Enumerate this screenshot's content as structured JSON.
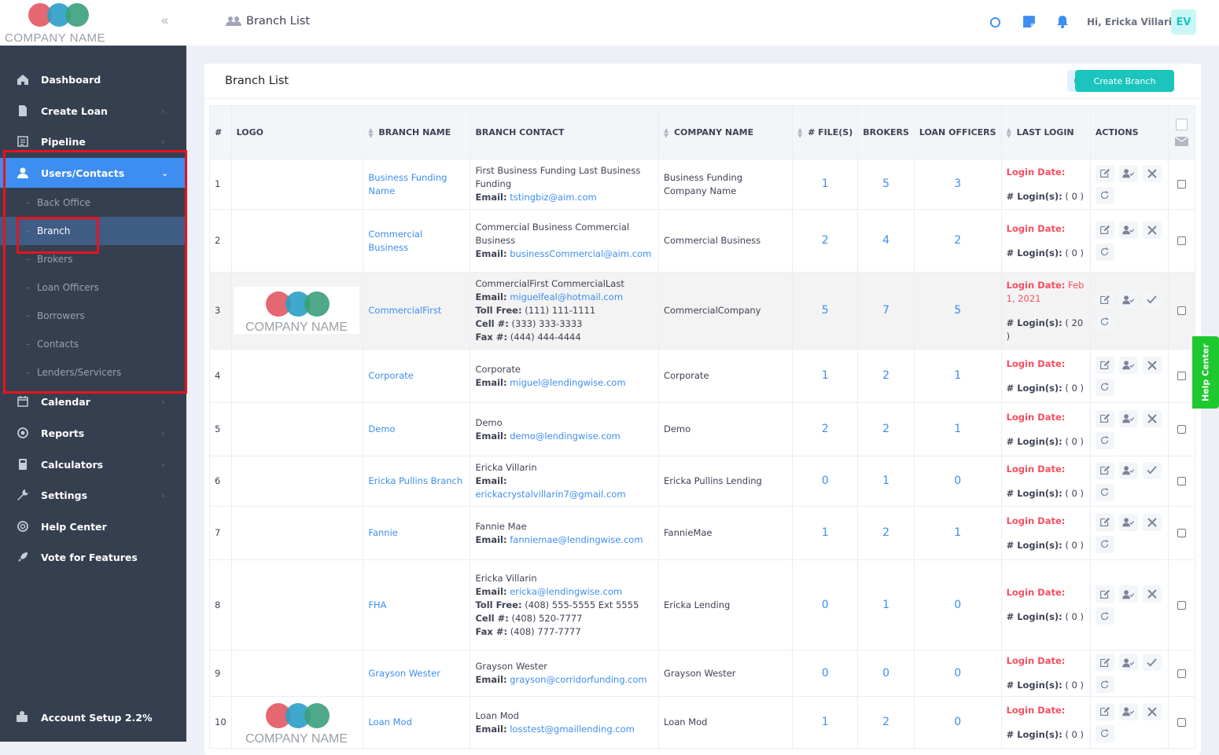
{
  "app": {
    "logo_text": "COMPANY NAME",
    "page_title": "Branch List"
  },
  "user": {
    "greeting": "Hi, Ericka Villarin",
    "initials": "EV"
  },
  "sidebar": {
    "items": [
      {
        "label": "Dashboard",
        "icon": "home-icon"
      },
      {
        "label": "Create Loan",
        "icon": "file-icon"
      },
      {
        "label": "Pipeline",
        "icon": "list-icon"
      },
      {
        "label": "Users/Contacts",
        "icon": "user-icon"
      },
      {
        "label": "Calendar",
        "icon": "calendar-icon"
      },
      {
        "label": "Reports",
        "icon": "chart-icon"
      },
      {
        "label": "Calculators",
        "icon": "calculator-icon"
      },
      {
        "label": "Settings",
        "icon": "wrench-icon"
      },
      {
        "label": "Help Center",
        "icon": "lifebuoy-icon"
      },
      {
        "label": "Vote for Features",
        "icon": "rocket-icon"
      }
    ],
    "sub_items": [
      "Back Office",
      "Branch",
      "Brokers",
      "Loan Officers",
      "Borrowers",
      "Contacts",
      "Lenders/Servicers"
    ],
    "account": "Account Setup 2.2%"
  },
  "card": {
    "title": "Branch List",
    "create_label": "Create Branch"
  },
  "table": {
    "headers": [
      "#",
      "LOGO",
      "BRANCH NAME",
      "BRANCH CONTACT",
      "COMPANY NAME",
      "# FILE(S)",
      "BROKERS",
      "LOAN OFFICERS",
      "LAST LOGIN",
      "ACTIONS"
    ],
    "login_date_label": "Login Date:",
    "logins_label": "# Login(s):",
    "rows": [
      {
        "n": "1",
        "name": "Business Funding Name",
        "contact": [
          "First Business Funding Last Business Funding"
        ],
        "email": "tstingbiz@aim.com",
        "company": "Business Funding Company Name",
        "files": "1",
        "brokers": "5",
        "los": "3",
        "login_date": "",
        "logins": "( 0 )",
        "logo": false,
        "active": false
      },
      {
        "n": "2",
        "name": "Commercial Business",
        "contact": [
          "Commercial Business Commercial Business"
        ],
        "email": "businessCommercial@aim.com",
        "company": "Commercial Business",
        "files": "2",
        "brokers": "4",
        "los": "2",
        "login_date": "",
        "logins": "( 0 )",
        "logo": false,
        "active": false
      },
      {
        "n": "3",
        "name": "CommercialFirst",
        "contact": [
          "CommercialFirst CommercialLast"
        ],
        "email": "miguelfeal@hotmail.com",
        "toll": "(111) 111-1111",
        "cell": "(333) 333-3333",
        "fax": "(444) 444-4444",
        "company": "CommercialCompany",
        "files": "5",
        "brokers": "7",
        "los": "5",
        "login_date": "Feb 1, 2021",
        "logins": "( 20 )",
        "logo": true,
        "active": true
      },
      {
        "n": "4",
        "name": "Corporate",
        "contact": [
          "Corporate"
        ],
        "email": "miguel@lendingwise.com",
        "company": "Corporate",
        "files": "1",
        "brokers": "2",
        "los": "1",
        "login_date": "",
        "logins": "( 0 )",
        "logo": false,
        "active": false
      },
      {
        "n": "5",
        "name": "Demo",
        "contact": [
          "Demo"
        ],
        "email": "demo@lendingwise.com",
        "company": "Demo",
        "files": "2",
        "brokers": "2",
        "los": "1",
        "login_date": "",
        "logins": "( 0 )",
        "logo": false,
        "active": false
      },
      {
        "n": "6",
        "name": "Ericka Pullins Branch",
        "contact": [
          "Ericka Villarin"
        ],
        "email": "erickacrystalvillarin7@gmail.com",
        "company": "Ericka Pullins Lending",
        "files": "0",
        "brokers": "1",
        "los": "0",
        "login_date": "",
        "logins": "( 0 )",
        "logo": false,
        "active": true
      },
      {
        "n": "7",
        "name": "Fannie",
        "contact": [
          "Fannie Mae"
        ],
        "email": "fanniemae@lendingwise.com",
        "company": "FannieMae",
        "files": "1",
        "brokers": "2",
        "los": "1",
        "login_date": "",
        "logins": "( 0 )",
        "logo": false,
        "active": false
      },
      {
        "n": "8",
        "name": "FHA",
        "contact": [
          "Ericka Villarin"
        ],
        "email": "ericka@lendingwise.com",
        "toll": "(408) 555-5555 Ext 5555",
        "cell": "(408) 520-7777",
        "fax": "(408) 777-7777",
        "company": "Ericka Lending",
        "files": "0",
        "brokers": "1",
        "los": "0",
        "login_date": "",
        "logins": "( 0 )",
        "logo": false,
        "active": false
      },
      {
        "n": "9",
        "name": "Grayson Wester",
        "contact": [
          "Grayson Wester"
        ],
        "email": "grayson@corridorfunding.com",
        "company": "Grayson Wester",
        "files": "0",
        "brokers": "0",
        "los": "0",
        "login_date": "",
        "logins": "( 0 )",
        "logo": false,
        "active": true
      },
      {
        "n": "10",
        "name": "Loan Mod",
        "contact": [
          "Loan Mod"
        ],
        "email": "losstest@gmaillending.com",
        "company": "Loan Mod",
        "files": "1",
        "brokers": "2",
        "los": "0",
        "login_date": "",
        "logins": "( 0 )",
        "logo": true,
        "active": false
      }
    ]
  },
  "labels": {
    "email": "Email:",
    "toll": "Toll Free:",
    "cell": "Cell #:",
    "fax": "Fax #:"
  },
  "help_center": "Help Center",
  "colors": {
    "accent": "#3d8ef0",
    "sidebar": "#353f4f",
    "success": "#1bc5bd",
    "danger": "#f64e60",
    "highlight": "#e8131c"
  }
}
